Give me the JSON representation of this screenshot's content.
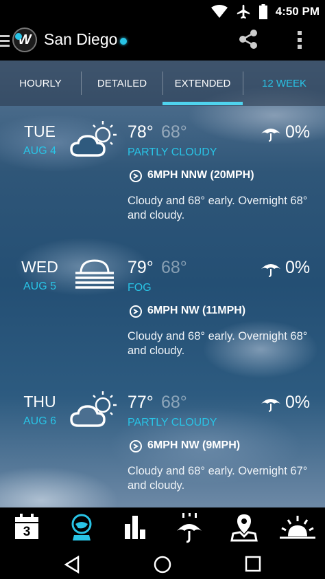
{
  "status_bar": {
    "time": "4:50",
    "ampm": "PM",
    "icons": [
      "wifi-icon",
      "airplane-icon",
      "battery-icon"
    ]
  },
  "app_bar": {
    "city": "San Diego",
    "logo_text": "W",
    "icons": [
      "menu-icon",
      "share-icon",
      "overflow-icon"
    ]
  },
  "tabs": [
    {
      "label": "HOURLY"
    },
    {
      "label": "DETAILED"
    },
    {
      "label": "EXTENDED",
      "selected": true
    },
    {
      "label": "12 WEEK"
    }
  ],
  "days": [
    {
      "day": "TUE",
      "date": "AUG 4",
      "icon": "partly-cloudy-icon",
      "high": "78°",
      "low": "68°",
      "condition": "PARTLY CLOUDY",
      "precip": "0%",
      "wind": "6MPH NNW (20MPH)",
      "description": "Cloudy and 68° early. Overnight 68° and cloudy."
    },
    {
      "day": "WED",
      "date": "AUG 5",
      "icon": "fog-icon",
      "high": "79°",
      "low": "68°",
      "condition": "FOG",
      "precip": "0%",
      "wind": "6MPH NW (11MPH)",
      "description": "Cloudy and 68° early. Overnight 68° and cloudy."
    },
    {
      "day": "THU",
      "date": "AUG 6",
      "icon": "partly-cloudy-icon",
      "high": "77°",
      "low": "68°",
      "condition": "PARTLY CLOUDY",
      "precip": "0%",
      "wind": "6MPH NW (9MPH)",
      "description": "Cloudy and 68° early. Overnight 67° and cloudy."
    }
  ],
  "bottom_nav": {
    "calendar_number": "3",
    "items": [
      "calendar-icon",
      "globe-icon",
      "bar-chart-icon",
      "rain-umbrella-icon",
      "map-pin-icon",
      "sunrise-icon"
    ],
    "active_index": 1
  },
  "colors": {
    "accent": "#29c4e6",
    "background": "#000000"
  }
}
